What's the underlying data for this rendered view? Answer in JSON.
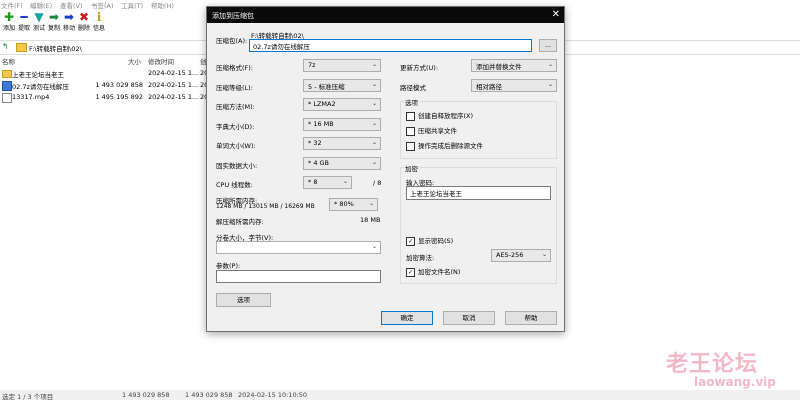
{
  "menu": [
    "文件(F)",
    "编辑(E)",
    "查看(V)",
    "书签(A)",
    "工具(T)",
    "帮助(H)"
  ],
  "toolbar": [
    {
      "label": "添加",
      "icon": "plus-icon",
      "glyph": "✚",
      "color": "#1a9a1a"
    },
    {
      "label": "提取",
      "icon": "minus-icon",
      "glyph": "━",
      "color": "#1a3fc8"
    },
    {
      "label": "测试",
      "icon": "check-arrow-icon",
      "glyph": "▼",
      "color": "#13a3a3"
    },
    {
      "label": "复制",
      "icon": "copy-arrow-icon",
      "glyph": "➡",
      "color": "#1a8a3a"
    },
    {
      "label": "移动",
      "icon": "move-arrow-icon",
      "glyph": "➡",
      "color": "#1a3fc8"
    },
    {
      "label": "删除",
      "icon": "delete-x-icon",
      "glyph": "✖",
      "color": "#d11a1a"
    },
    {
      "label": "信息",
      "icon": "info-icon",
      "glyph": "ℹ",
      "color": "#c8a010"
    }
  ],
  "address": "F:\\转载转自制\\02\\",
  "columns": {
    "name": "名称",
    "size": "大小",
    "modified": "修改时间",
    "created": "创"
  },
  "files": [
    {
      "name": "上老王论坛当老王",
      "size": "",
      "modified": "2024-02-15 1...",
      "created": "20"
    },
    {
      "name": "02.7z请勿在线解压",
      "size": "1 493 029 858",
      "modified": "2024-02-15 1...",
      "created": "20"
    },
    {
      "name": "13317.mp4",
      "size": "1 495 195 892",
      "modified": "2024-02-15 1...",
      "created": "20"
    }
  ],
  "status": {
    "selection": "选定 1 / 3 个项目",
    "s1": "1 493 029 858",
    "s2": "1 493 029 858",
    "date": "2024-02-15 10:10:50"
  },
  "dialog": {
    "title": "添加到压缩包",
    "archive_label": "压缩包(A):",
    "archive_path": "F:\\转载转自制\\02\\",
    "archive_name": "02.7z请勿在线解压",
    "browse": "...",
    "format_label": "压缩格式(F):",
    "format_value": "7z",
    "level_label": "压缩等级(L):",
    "level_value": "5 - 标准压缩",
    "method_label": "压缩方法(M):",
    "method_value": "* LZMA2",
    "dict_label": "字典大小(D):",
    "dict_value": "* 16 MB",
    "word_label": "单词大小(W):",
    "word_value": "* 32",
    "solid_label": "固实数据大小:",
    "solid_value": "* 4 GB",
    "cpu_label": "CPU 线程数:",
    "cpu_value": "* 8",
    "cpu_max": "/ 8",
    "mem_label": "压缩所需内存:",
    "mem_detail": "1248 MB / 13015 MB / 16269 MB",
    "mem_value": "* 80%",
    "demem_label": "解压缩所需内存:",
    "demem_value": "18 MB",
    "split_label": "分卷大小，字节(V):",
    "params_label": "参数(P):",
    "options_button": "选项",
    "update_label": "更新方式(U):",
    "update_value": "添加并替换文件",
    "path_label": "路径模式",
    "path_value": "相对路径",
    "options_group": "选项",
    "opt_sfx": "创建自释放程序(X)",
    "opt_shared": "压缩共享文件",
    "opt_delete": "操作完成后删除源文件",
    "encryption_group": "加密",
    "password_label": "输入密码:",
    "password_value": "上老王论坛当老王",
    "show_password": "显示密码(S)",
    "enc_method_label": "加密算法:",
    "enc_method_value": "AES-256",
    "encrypt_names": "加密文件名(N)",
    "ok": "确定",
    "cancel": "取消",
    "help": "帮助"
  },
  "watermark": {
    "title": "老王论坛",
    "url": "laowang.vip"
  }
}
